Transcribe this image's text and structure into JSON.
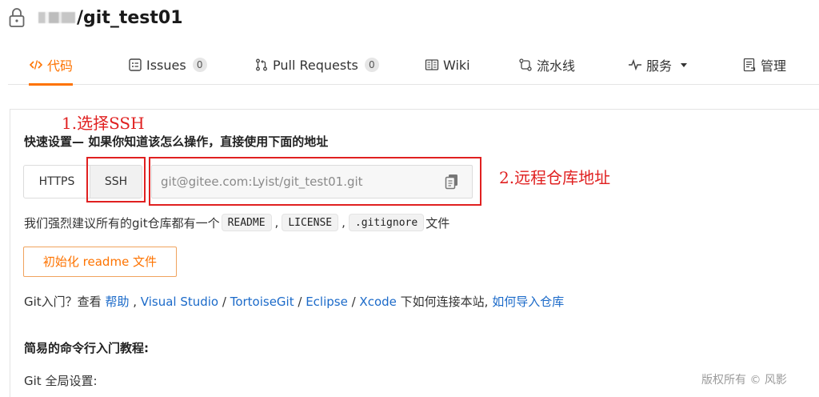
{
  "repo": {
    "name": "/git_test01"
  },
  "tabs": [
    {
      "label": "代码",
      "icon": "code-icon",
      "active": true
    },
    {
      "label": "Issues",
      "icon": "issues-icon",
      "count": "0"
    },
    {
      "label": "Pull Requests",
      "icon": "pull-request-icon",
      "count": "0"
    },
    {
      "label": "Wiki",
      "icon": "wiki-icon"
    },
    {
      "label": "流水线",
      "icon": "pipeline-icon"
    },
    {
      "label": "服务",
      "icon": "pulse-icon",
      "dropdown": true
    },
    {
      "label": "管理",
      "icon": "manage-icon"
    }
  ],
  "annotations": {
    "step1": "1.选择SSH",
    "step2": "2.远程仓库地址"
  },
  "quick_setup": {
    "title": "快速设置— 如果你知道该怎么操作，直接使用下面的地址",
    "https_label": "HTTPS",
    "ssh_label": "SSH",
    "selected_protocol": "SSH",
    "url": "git@gitee.com:Lyist/git_test01.git"
  },
  "recommend": {
    "prefix": "我们强烈建议所有的git仓库都有一个",
    "files": [
      "README",
      "LICENSE",
      ".gitignore"
    ],
    "sep1": ",",
    "sep2": ",",
    "suffix": "文件"
  },
  "init_button": "初始化 readme 文件",
  "help_line": {
    "prefix": "Git入门？查看 ",
    "help": "帮助",
    "sep1": " , ",
    "vs": "Visual Studio",
    "sep2": " / ",
    "tortoise": "TortoiseGit",
    "sep3": " / ",
    "eclipse": "Eclipse",
    "sep4": " / ",
    "xcode": "Xcode",
    "middle": " 下如何连接本站, ",
    "import": "如何导入仓库"
  },
  "tutorial_title": "简易的命令行入门教程:",
  "git_global": "Git 全局设置:",
  "watermark": "版权所有 © 风影",
  "colors": {
    "accent": "#fe7300",
    "annotation": "#e02020",
    "link": "#1b6ac9"
  }
}
